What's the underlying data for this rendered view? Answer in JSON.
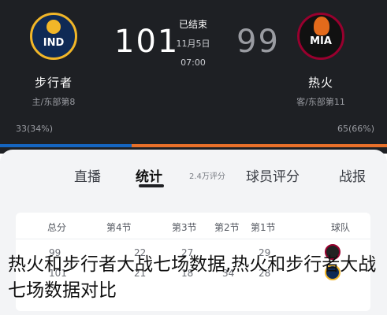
{
  "header": {
    "home": {
      "name": "步行者",
      "sub": "主/东部第8",
      "logo_text": "IND",
      "win_pct": "33(34%)",
      "score": "101"
    },
    "away": {
      "name": "热火",
      "sub": "客/东部第11",
      "logo_text": "MIA",
      "win_pct": "65(66%)",
      "score": "99"
    },
    "status": "已结束",
    "date": "11月5日",
    "time": "07:00",
    "bar": {
      "home_share": 0.34,
      "home_color": "#1565c0",
      "away_color": "#e8702a"
    }
  },
  "tabs": {
    "live": "直播",
    "stats": "统计",
    "stats_count": "2.4万评分",
    "ratings": "球员评分",
    "report": "战报"
  },
  "table": {
    "headers": {
      "team": "球队",
      "q1": "第1节",
      "q2": "第2节",
      "q3": "第3节",
      "q4": "第4节",
      "total": "总分"
    },
    "rows": [
      {
        "team": "MIA",
        "q1": "29",
        "q2": "",
        "q3": "27",
        "q4": "22",
        "total": "99"
      },
      {
        "team": "IND",
        "q1": "28",
        "q2": "34",
        "q3": "18",
        "q4": "21",
        "total": "101"
      }
    ]
  },
  "caption": "热火和步行者大战七场数据,热火和步行者大战七场数据对比"
}
